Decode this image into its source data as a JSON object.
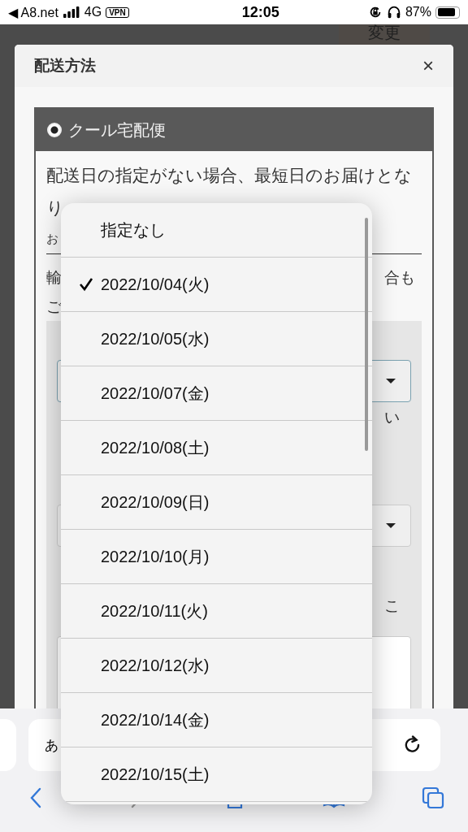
{
  "status_bar": {
    "back_label": "◀ A8.net",
    "network": "4G",
    "vpn": "VPN",
    "time": "12:05",
    "battery": "87%"
  },
  "background_button": "変更",
  "modal": {
    "title": "配送方法",
    "close": "×",
    "option": {
      "label": "クール宅配便",
      "selected": true
    },
    "notice": "配送日の指定がない場合、最短日のお届けとなり",
    "fragments": [
      {
        "left": "お"
      },
      {
        "left": "輸",
        "right": "合も"
      },
      {
        "left": "ご"
      }
    ],
    "select_note": "い",
    "second_note": "こ"
  },
  "date_picker": {
    "items": [
      {
        "label": "指定なし",
        "selected": false
      },
      {
        "label": "2022/10/04(火)",
        "selected": true
      },
      {
        "label": "2022/10/05(水)",
        "selected": false
      },
      {
        "label": "2022/10/07(金)",
        "selected": false
      },
      {
        "label": "2022/10/08(土)",
        "selected": false
      },
      {
        "label": "2022/10/09(日)",
        "selected": false
      },
      {
        "label": "2022/10/10(月)",
        "selected": false
      },
      {
        "label": "2022/10/11(火)",
        "selected": false
      },
      {
        "label": "2022/10/12(水)",
        "selected": false
      },
      {
        "label": "2022/10/14(金)",
        "selected": false
      },
      {
        "label": "2022/10/15(土)",
        "selected": false
      }
    ]
  },
  "browser": {
    "address_text": "あ"
  }
}
